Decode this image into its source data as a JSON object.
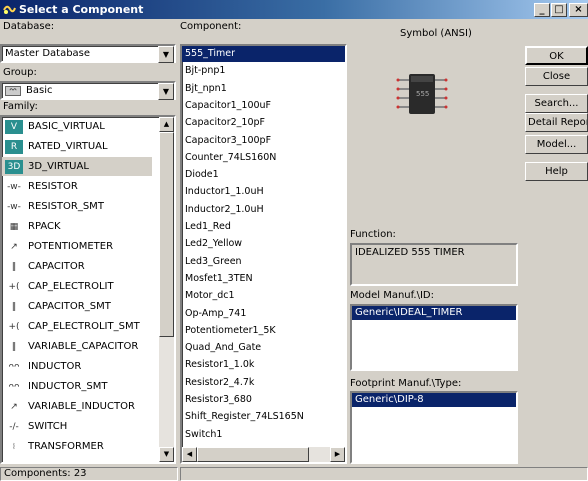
{
  "window": {
    "title": "Select a Component",
    "minimize": "_",
    "maximize": "□",
    "close": "×"
  },
  "database": {
    "label": "Database:",
    "value": "Master Database"
  },
  "group": {
    "label": "Group:",
    "value": "Basic"
  },
  "family": {
    "label": "Family:",
    "items": [
      {
        "label": "BASIC_VIRTUAL",
        "icon": "basic-virtual-icon",
        "glyph": "V"
      },
      {
        "label": "RATED_VIRTUAL",
        "icon": "rated-virtual-icon",
        "glyph": "R"
      },
      {
        "label": "3D_VIRTUAL",
        "icon": "3d-virtual-icon",
        "glyph": "3D"
      },
      {
        "label": "RESISTOR",
        "icon": "resistor-icon",
        "glyph": "-w-"
      },
      {
        "label": "RESISTOR_SMT",
        "icon": "resistor-smt-icon",
        "glyph": "-w-"
      },
      {
        "label": "RPACK",
        "icon": "rpack-icon",
        "glyph": "▦"
      },
      {
        "label": "POTENTIOMETER",
        "icon": "potentiometer-icon",
        "glyph": "↗"
      },
      {
        "label": "CAPACITOR",
        "icon": "capacitor-icon",
        "glyph": "‖"
      },
      {
        "label": "CAP_ELECTROLIT",
        "icon": "cap-electrolit-icon",
        "glyph": "+("
      },
      {
        "label": "CAPACITOR_SMT",
        "icon": "capacitor-smt-icon",
        "glyph": "‖"
      },
      {
        "label": "CAP_ELECTROLIT_SMT",
        "icon": "cap-electrolit-smt-icon",
        "glyph": "+("
      },
      {
        "label": "VARIABLE_CAPACITOR",
        "icon": "variable-capacitor-icon",
        "glyph": "‖"
      },
      {
        "label": "INDUCTOR",
        "icon": "inductor-icon",
        "glyph": "ᴖᴖ"
      },
      {
        "label": "INDUCTOR_SMT",
        "icon": "inductor-smt-icon",
        "glyph": "ᴖᴖ"
      },
      {
        "label": "VARIABLE_INDUCTOR",
        "icon": "variable-inductor-icon",
        "glyph": "↗"
      },
      {
        "label": "SWITCH",
        "icon": "switch-icon",
        "glyph": "-/-"
      },
      {
        "label": "TRANSFORMER",
        "icon": "transformer-icon",
        "glyph": "⧘"
      }
    ]
  },
  "component": {
    "label": "Component:",
    "items": [
      "555_Timer",
      "Bjt-pnp1",
      "Bjt_npn1",
      "Capacitor1_100uF",
      "Capacitor2_10pF",
      "Capacitor3_100pF",
      "Counter_74LS160N",
      "Diode1",
      "Inductor1_1.0uH",
      "Inductor2_1.0uH",
      "Led1_Red",
      "Led2_Yellow",
      "Led3_Green",
      "Mosfet1_3TEN",
      "Motor_dc1",
      "Op-Amp_741",
      "Potentiometer1_5K",
      "Quad_And_Gate",
      "Resistor1_1.0k",
      "Resistor2_4.7k",
      "Resistor3_680",
      "Shift_Register_74LS165N",
      "Switch1"
    ]
  },
  "symbol": {
    "label": "Symbol (ANSI)",
    "chip_text": "555"
  },
  "function": {
    "label": "Function:",
    "value": "IDEALIZED 555 TIMER"
  },
  "model": {
    "label": "Model Manuf.\\ID:",
    "selected": "Generic\\IDEAL_TIMER"
  },
  "footprint": {
    "label": "Footprint Manuf.\\Type:",
    "selected": "Generic\\DIP-8"
  },
  "buttons": {
    "ok": "OK",
    "close": "Close",
    "search": "Search...",
    "detail_report": "Detail Report",
    "model": "Model...",
    "help": "Help"
  },
  "status": {
    "components": "Components: 23"
  },
  "colors": {
    "selection": "#0a246a",
    "face": "#d4d0c8"
  }
}
